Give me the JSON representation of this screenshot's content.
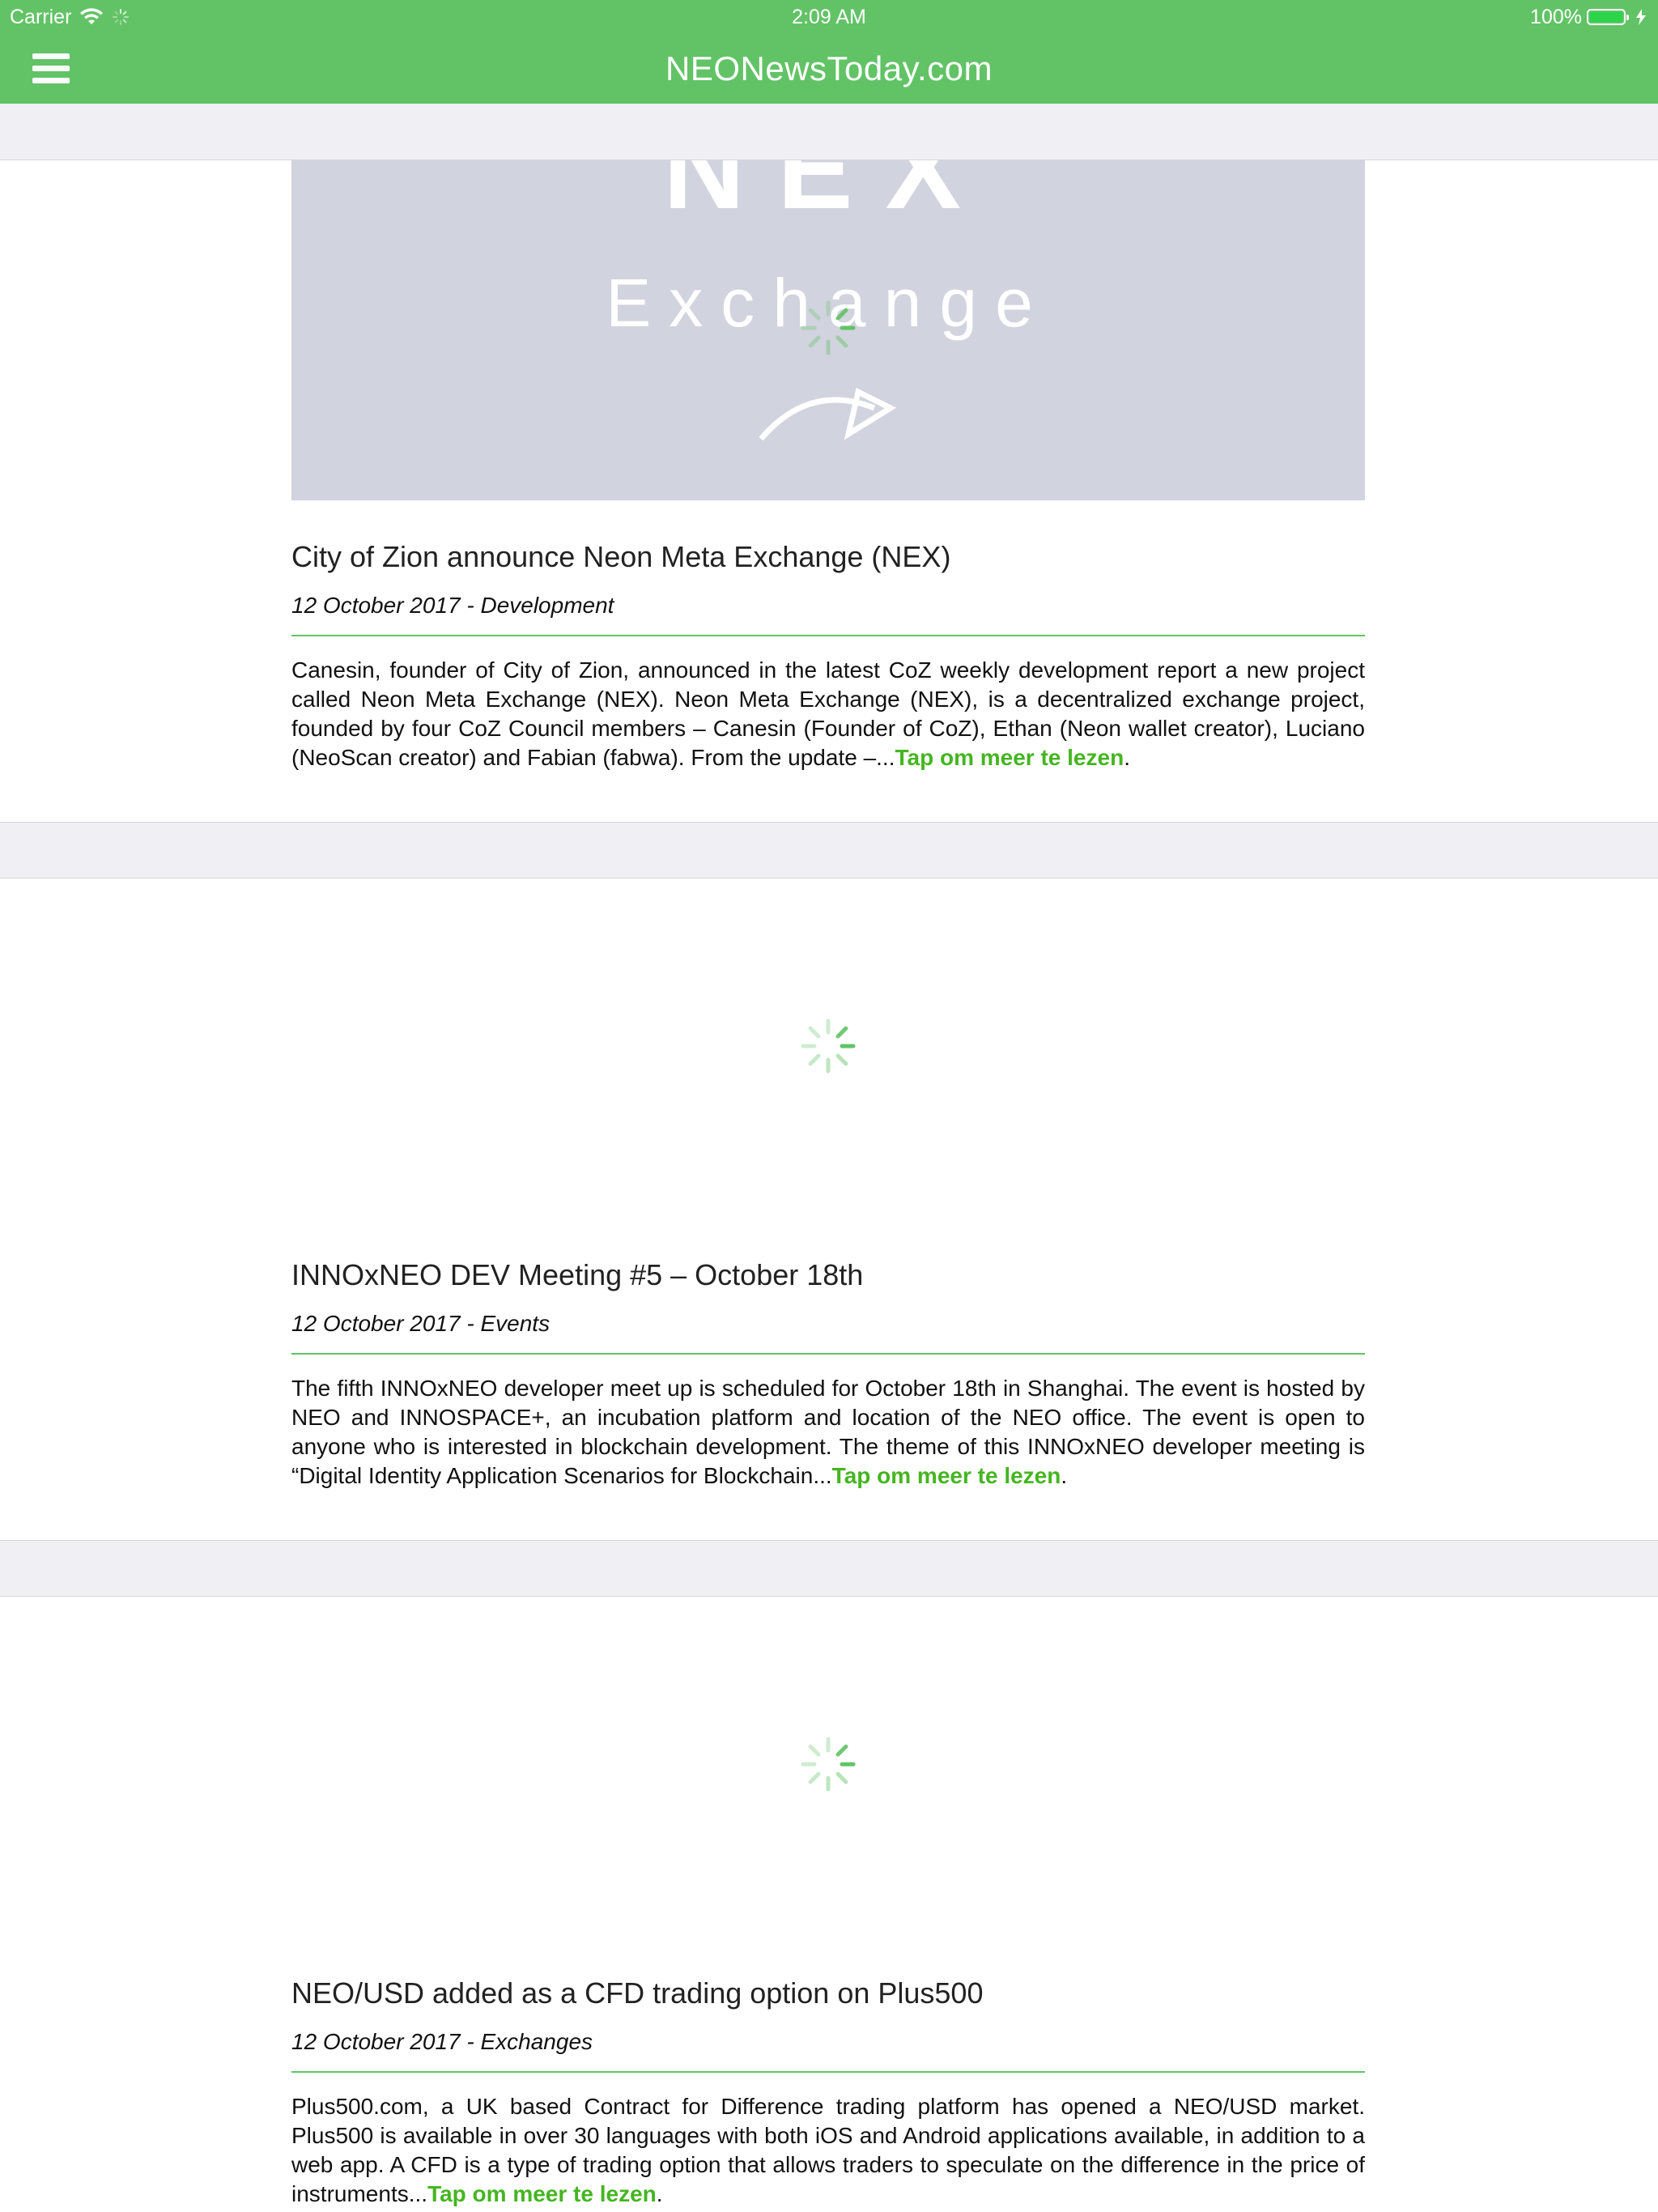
{
  "status_bar": {
    "carrier": "Carrier",
    "time": "2:09 AM",
    "battery": "100%"
  },
  "nav": {
    "title": "NEONewsToday.com",
    "menu_icon": "hamburger-menu-icon"
  },
  "colors": {
    "brand_green": "#62c366",
    "link_green": "#45b521",
    "separator_gray": "#efeff4",
    "image_placeholder": "#d1d3de"
  },
  "articles": [
    {
      "image_text_top": "NEX",
      "image_text_bottom": "Exchange",
      "title": "City of Zion announce Neon Meta Exchange (NEX)",
      "meta": "12 October 2017 - Development",
      "excerpt": "Canesin, founder of City of Zion, announced in the latest CoZ weekly development report a new project called Neon Meta Exchange (NEX). Neon Meta Exchange (NEX), is a decentralized exchange project, founded by four CoZ Council members – Canesin (Founder of CoZ), Ethan (Neon wallet creator), Luciano (NeoScan creator) and Fabian (fabwa). From the update –...",
      "read_more": "Tap om meer te lezen",
      "trail": "."
    },
    {
      "title": "INNOxNEO DEV Meeting #5 – October 18th",
      "meta": "12 October 2017 - Events",
      "excerpt": "The fifth INNOxNEO developer meet up is scheduled for October 18th in Shanghai. The event is hosted by NEO and INNOSPACE+, an incubation platform and location of the NEO office. The event is open to anyone who is interested in blockchain development. The theme of this INNOxNEO developer meeting is “Digital Identity Application Scenarios for Blockchain...",
      "read_more": "Tap om meer te lezen",
      "trail": "."
    },
    {
      "title": "NEO/USD added as a CFD trading option on Plus500",
      "meta": "12 October 2017 - Exchanges",
      "excerpt": "Plus500.com, a UK based Contract for Difference trading platform has opened a NEO/USD market. Plus500 is available in over 30 languages with both iOS and Android applications available, in addition to a web app. A CFD is a type of trading option that allows traders to speculate on the difference in the price of instruments...",
      "read_more": "Tap om meer te lezen",
      "trail": "."
    }
  ]
}
